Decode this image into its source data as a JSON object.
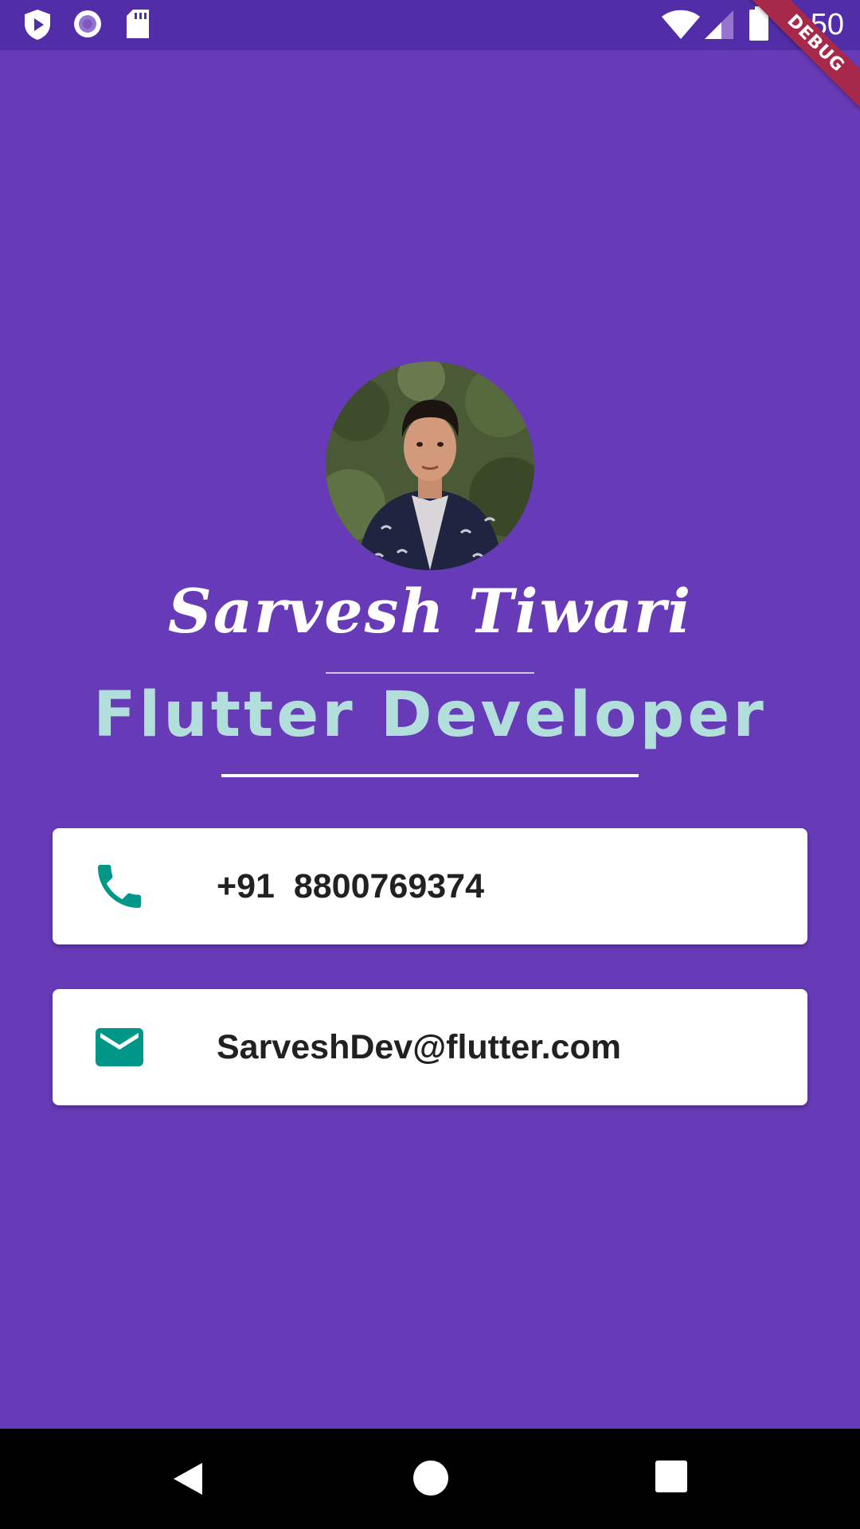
{
  "status_bar": {
    "time": "2:50",
    "icons": [
      "play-protect-icon",
      "record-icon",
      "sd-card-icon",
      "wifi-icon",
      "signal-icon",
      "battery-icon"
    ]
  },
  "debug_banner": "DEBUG",
  "profile": {
    "name": "Sarvesh Tiwari",
    "title": "Flutter Developer",
    "avatar_icon": "profile-photo"
  },
  "contacts": {
    "phone": {
      "icon": "phone-icon",
      "text": "+91  8800769374"
    },
    "email": {
      "icon": "email-icon",
      "text": "SarveshDev@flutter.com"
    }
  },
  "nav_bar": {
    "buttons": [
      "back-icon",
      "home-icon",
      "recents-icon"
    ]
  },
  "colors": {
    "background": "#673ab7",
    "status_bar": "#512da8",
    "title_text": "#b2dfdb",
    "icon_teal": "#009688",
    "card_text": "#212121",
    "debug_banner": "#a6294a"
  }
}
